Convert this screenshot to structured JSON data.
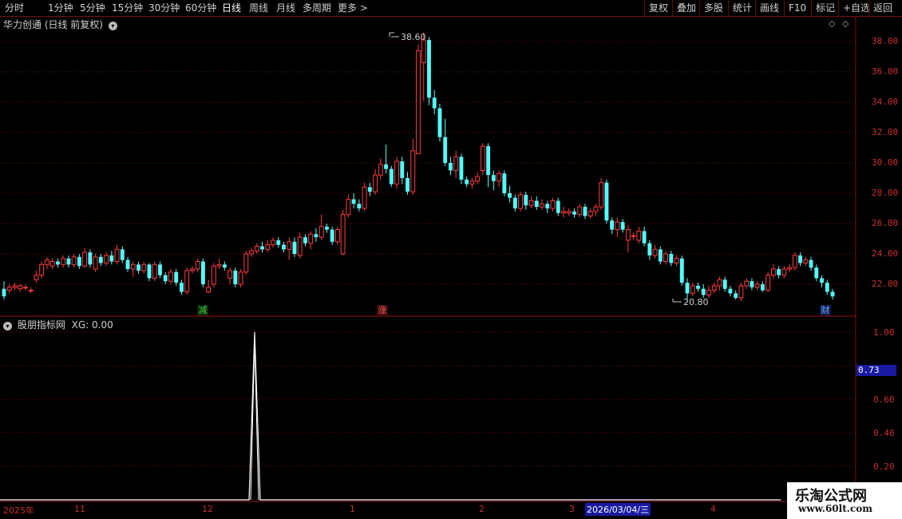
{
  "toolbar": {
    "periods": [
      "分时",
      "1分钟",
      "5分钟",
      "15分钟",
      "30分钟",
      "60分钟",
      "日线",
      "周线",
      "月线",
      "多周期",
      "更多 >"
    ],
    "active_period": "日线",
    "right_buttons": [
      "复权",
      "叠加",
      "多股",
      "统计",
      "画线",
      "F10",
      "标记",
      "+自选",
      "返回"
    ]
  },
  "main_panel": {
    "title": "华力创通 (日线 前复权)",
    "high_label": "38.60",
    "low_label": "20.80",
    "signals": [
      {
        "text": "减",
        "color": "#2a8a2a"
      },
      {
        "text": "涨",
        "color": "#a02020"
      },
      {
        "text": "财",
        "color": "#2050a0"
      }
    ],
    "y_ticks": [
      "38.00",
      "36.00",
      "34.00",
      "32.00",
      "30.00",
      "28.00",
      "26.00",
      "24.00",
      "22.00"
    ]
  },
  "indicator_panel": {
    "title": "股朋指标网",
    "formula_label": "XG: 0.00",
    "y_ticks": [
      "1.00",
      "0.60",
      "0.40",
      "0.20"
    ],
    "current_value": "0.73"
  },
  "date_axis": {
    "labels": [
      "2025年",
      "11",
      "12",
      "1",
      "2",
      "3",
      "4"
    ],
    "cursor_date": "2026/03/04/三"
  },
  "watermark": {
    "title": "乐淘公式网",
    "url": "www.60lt.com"
  },
  "colors": {
    "up": "#ff3c3c",
    "down": "#54ffff",
    "grid": "#7a1010",
    "axis": "#c83030",
    "line": "#ffffff"
  },
  "chart_data": {
    "type": "candlestick",
    "ylim": [
      20.5,
      39.5
    ],
    "candles": [
      [
        21.7,
        21.2,
        22.2,
        21.0
      ],
      [
        21.6,
        21.8,
        22.0,
        21.4
      ],
      [
        21.8,
        21.9,
        22.1,
        21.6
      ],
      [
        21.7,
        21.9,
        22.0,
        21.5
      ],
      [
        21.8,
        21.8,
        22.0,
        21.6
      ],
      [
        21.6,
        21.6,
        21.8,
        21.4
      ],
      [
        22.3,
        22.6,
        22.9,
        22.1
      ],
      [
        22.6,
        23.3,
        23.5,
        22.4
      ],
      [
        23.3,
        23.6,
        23.8,
        23.0
      ],
      [
        23.2,
        23.5,
        23.7,
        23.0
      ],
      [
        23.5,
        23.3,
        23.7,
        23.1
      ],
      [
        23.3,
        23.7,
        23.9,
        23.1
      ],
      [
        23.7,
        23.3,
        23.9,
        23.1
      ],
      [
        23.3,
        23.8,
        24.0,
        23.1
      ],
      [
        23.8,
        23.2,
        24.0,
        23.0
      ],
      [
        23.2,
        24.1,
        24.4,
        23.1
      ],
      [
        24.1,
        23.3,
        24.3,
        23.1
      ],
      [
        23.0,
        23.8,
        24.0,
        22.8
      ],
      [
        23.8,
        23.4,
        24.0,
        23.2
      ],
      [
        23.4,
        23.9,
        24.1,
        23.2
      ],
      [
        23.9,
        23.5,
        24.2,
        23.3
      ],
      [
        23.5,
        24.3,
        24.6,
        23.3
      ],
      [
        24.3,
        23.6,
        24.5,
        23.4
      ],
      [
        23.6,
        23.0,
        23.8,
        22.8
      ],
      [
        23.0,
        23.3,
        23.5,
        22.5
      ],
      [
        23.3,
        22.9,
        23.5,
        22.7
      ],
      [
        22.9,
        23.3,
        23.5,
        22.7
      ],
      [
        23.3,
        22.4,
        23.4,
        22.2
      ],
      [
        22.4,
        23.3,
        23.5,
        22.2
      ],
      [
        23.3,
        22.6,
        23.5,
        22.4
      ],
      [
        22.6,
        22.2,
        22.8,
        22.0
      ],
      [
        22.2,
        22.8,
        23.0,
        22.0
      ],
      [
        22.8,
        22.1,
        23.0,
        21.9
      ],
      [
        22.1,
        21.5,
        22.3,
        21.3
      ],
      [
        21.5,
        22.9,
        23.1,
        21.3
      ],
      [
        22.9,
        23.0,
        23.2,
        22.7
      ],
      [
        23.0,
        23.5,
        23.7,
        22.8
      ],
      [
        23.5,
        22.0,
        23.7,
        21.8
      ],
      [
        21.5,
        21.8,
        22.3,
        21.4
      ],
      [
        22.0,
        23.2,
        23.4,
        21.8
      ],
      [
        23.2,
        23.3,
        23.7,
        23.0
      ],
      [
        23.3,
        23.1,
        23.5,
        22.9
      ],
      [
        22.4,
        22.9,
        23.1,
        22.0
      ],
      [
        22.9,
        22.0,
        23.1,
        21.8
      ],
      [
        22.0,
        22.8,
        23.0,
        21.8
      ],
      [
        22.8,
        24.0,
        24.2,
        22.6
      ],
      [
        24.0,
        24.2,
        24.4,
        23.8
      ],
      [
        24.2,
        24.5,
        24.7,
        24.0
      ],
      [
        24.5,
        24.3,
        24.8,
        24.1
      ],
      [
        24.3,
        24.6,
        24.9,
        24.1
      ],
      [
        24.6,
        24.9,
        25.1,
        24.4
      ],
      [
        24.9,
        24.6,
        25.1,
        24.4
      ],
      [
        24.6,
        24.3,
        24.8,
        24.1
      ],
      [
        24.3,
        24.8,
        25.1,
        23.6
      ],
      [
        24.8,
        24.0,
        25.1,
        23.8
      ],
      [
        23.9,
        25.1,
        25.4,
        23.7
      ],
      [
        25.1,
        24.7,
        25.3,
        24.5
      ],
      [
        24.7,
        25.3,
        25.5,
        24.3
      ],
      [
        25.3,
        25.1,
        25.7,
        24.8
      ],
      [
        25.1,
        25.8,
        26.6,
        24.9
      ],
      [
        25.8,
        25.6,
        26.0,
        25.4
      ],
      [
        25.6,
        24.8,
        25.8,
        24.6
      ],
      [
        24.8,
        25.6,
        25.8,
        24.6
      ],
      [
        24.0,
        26.6,
        26.9,
        23.9
      ],
      [
        26.6,
        27.6,
        27.9,
        26.4
      ],
      [
        27.6,
        27.3,
        28.0,
        27.0
      ],
      [
        27.3,
        27.0,
        27.6,
        26.8
      ],
      [
        27.0,
        28.4,
        28.7,
        26.8
      ],
      [
        28.4,
        28.1,
        28.7,
        27.8
      ],
      [
        28.1,
        29.2,
        29.6,
        27.9
      ],
      [
        29.2,
        29.9,
        30.3,
        28.9
      ],
      [
        29.9,
        29.6,
        31.2,
        29.3
      ],
      [
        29.6,
        28.6,
        29.8,
        28.4
      ],
      [
        28.6,
        30.1,
        30.4,
        28.3
      ],
      [
        30.1,
        29.0,
        30.4,
        28.6
      ],
      [
        29.0,
        28.1,
        29.4,
        27.9
      ],
      [
        28.1,
        30.8,
        31.6,
        27.9
      ],
      [
        30.6,
        37.4,
        37.8,
        31.9
      ],
      [
        36.6,
        38.1,
        38.6,
        34.1
      ],
      [
        38.1,
        34.3,
        38.3,
        33.8
      ],
      [
        34.3,
        33.6,
        34.8,
        33.2
      ],
      [
        33.6,
        31.7,
        33.9,
        31.4
      ],
      [
        31.7,
        30.0,
        32.9,
        29.8
      ],
      [
        30.0,
        29.5,
        30.4,
        29.2
      ],
      [
        29.5,
        30.4,
        30.8,
        29.0
      ],
      [
        30.4,
        28.9,
        30.6,
        28.6
      ],
      [
        28.9,
        28.6,
        29.1,
        28.4
      ],
      [
        28.6,
        28.8,
        29.0,
        28.3
      ],
      [
        28.8,
        29.1,
        29.4,
        28.6
      ],
      [
        29.5,
        31.1,
        31.3,
        29.2
      ],
      [
        31.1,
        29.2,
        31.3,
        28.4
      ],
      [
        29.2,
        28.8,
        29.5,
        28.2
      ],
      [
        28.8,
        29.3,
        29.5,
        28.4
      ],
      [
        29.3,
        28.0,
        29.5,
        27.8
      ],
      [
        28.0,
        27.7,
        28.5,
        27.4
      ],
      [
        27.7,
        27.0,
        27.9,
        26.8
      ],
      [
        27.0,
        27.9,
        28.1,
        26.8
      ],
      [
        27.9,
        27.2,
        28.1,
        26.9
      ],
      [
        27.2,
        27.5,
        27.8,
        27.0
      ],
      [
        27.5,
        27.1,
        27.8,
        26.9
      ],
      [
        27.1,
        27.3,
        27.6,
        26.9
      ],
      [
        27.3,
        27.0,
        27.5,
        26.7
      ],
      [
        27.0,
        27.5,
        27.7,
        26.8
      ],
      [
        27.5,
        26.7,
        27.7,
        26.5
      ],
      [
        26.7,
        26.8,
        27.1,
        26.4
      ],
      [
        26.7,
        26.8,
        27.0,
        26.5
      ],
      [
        26.8,
        26.6,
        27.0,
        26.4
      ],
      [
        26.6,
        27.1,
        27.3,
        26.4
      ],
      [
        27.1,
        26.5,
        27.3,
        26.3
      ],
      [
        26.5,
        26.8,
        27.0,
        26.3
      ],
      [
        26.8,
        27.1,
        27.3,
        26.5
      ],
      [
        27.1,
        28.7,
        29.0,
        26.9
      ],
      [
        28.7,
        26.2,
        28.9,
        26.0
      ],
      [
        26.2,
        25.6,
        26.4,
        25.3
      ],
      [
        25.6,
        26.1,
        26.4,
        25.1
      ],
      [
        26.1,
        25.6,
        26.3,
        25.4
      ],
      [
        24.9,
        25.6,
        25.9,
        24.1
      ],
      [
        25.2,
        25.2,
        25.4,
        24.9
      ],
      [
        24.9,
        25.5,
        25.8,
        24.7
      ],
      [
        25.5,
        24.7,
        25.8,
        24.5
      ],
      [
        24.7,
        23.9,
        24.9,
        23.6
      ],
      [
        23.9,
        24.3,
        24.6,
        23.7
      ],
      [
        24.3,
        23.5,
        24.5,
        23.3
      ],
      [
        23.5,
        24.0,
        24.2,
        23.3
      ],
      [
        24.0,
        23.4,
        24.2,
        23.2
      ],
      [
        23.4,
        23.7,
        23.9,
        23.2
      ],
      [
        23.7,
        22.1,
        23.9,
        21.9
      ],
      [
        22.1,
        21.4,
        22.4,
        20.8
      ],
      [
        21.4,
        21.9,
        22.1,
        21.2
      ],
      [
        21.9,
        21.7,
        22.1,
        21.5
      ],
      [
        21.7,
        21.3,
        22.0,
        21.1
      ],
      [
        21.3,
        21.6,
        21.9,
        21.1
      ],
      [
        21.6,
        21.9,
        22.1,
        21.4
      ],
      [
        21.9,
        22.3,
        22.5,
        21.6
      ],
      [
        22.3,
        21.7,
        22.5,
        21.5
      ],
      [
        21.7,
        21.4,
        21.9,
        21.2
      ],
      [
        21.4,
        21.1,
        21.6,
        21.0
      ],
      [
        21.1,
        21.9,
        22.1,
        20.9
      ],
      [
        21.9,
        22.2,
        22.4,
        21.7
      ],
      [
        22.2,
        21.8,
        22.4,
        21.6
      ],
      [
        21.8,
        22.0,
        22.2,
        21.6
      ],
      [
        22.0,
        21.6,
        22.2,
        21.5
      ],
      [
        21.6,
        22.6,
        22.8,
        21.5
      ],
      [
        22.6,
        23.0,
        23.3,
        22.4
      ],
      [
        23.0,
        22.6,
        23.2,
        22.4
      ],
      [
        22.6,
        23.0,
        23.2,
        22.4
      ],
      [
        23.0,
        23.1,
        23.3,
        22.8
      ],
      [
        23.1,
        23.9,
        24.1,
        22.9
      ],
      [
        23.9,
        23.4,
        24.1,
        23.2
      ],
      [
        23.4,
        23.6,
        23.8,
        23.2
      ],
      [
        23.6,
        23.1,
        23.8,
        22.9
      ],
      [
        23.1,
        22.4,
        23.3,
        22.2
      ],
      [
        22.4,
        22.1,
        22.6,
        21.8
      ],
      [
        22.1,
        21.5,
        22.3,
        21.3
      ],
      [
        21.5,
        21.2,
        21.7,
        21.0
      ]
    ]
  }
}
